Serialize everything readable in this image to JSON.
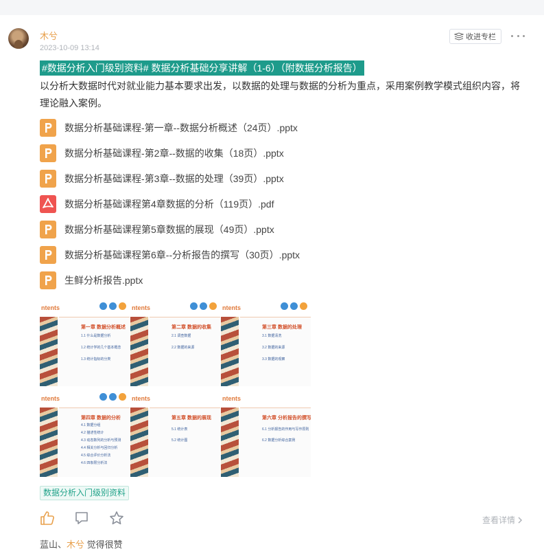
{
  "post": {
    "author": "木兮",
    "time": "2023-10-09 13:14",
    "collect_label": "收进专栏",
    "topic_line": "#数据分析入门级别资料# 数据分析基础分享讲解（1-6）（附数据分析报告）",
    "description": "以分析大数据时代对就业能力基本要求出发，以数据的处理与数据的分析为重点，采用案例教学模式组织内容，将理论融入案例。",
    "files": [
      {
        "name": "数据分析基础课程-第一章--数据分析概述（24页）.pptx",
        "type": "ppt",
        "icon": "ppt-file-icon"
      },
      {
        "name": "数据分析基础课程-第2章--数据的收集（18页）.pptx",
        "type": "ppt",
        "icon": "ppt-file-icon"
      },
      {
        "name": "数据分析基础课程-第3章--数据的处理（39页）.pptx",
        "type": "ppt",
        "icon": "ppt-file-icon"
      },
      {
        "name": "数据分析基础课程第4章数据的分析（119页）.pdf",
        "type": "pdf",
        "icon": "pdf-file-icon"
      },
      {
        "name": "数据分析基础课程第5章数据的展现（49页）.pptx",
        "type": "ppt",
        "icon": "ppt-file-icon"
      },
      {
        "name": "数据分析基础课程第6章--分析报告的撰写（30页）.pptx",
        "type": "ppt",
        "icon": "ppt-file-icon"
      },
      {
        "name": "生鲜分析报告.pptx",
        "type": "ppt",
        "icon": "ppt-file-icon"
      }
    ],
    "thumbnails": [
      {
        "header": "ntents",
        "chapter": "第一章 数据分析概述",
        "items": [
          "1.1 什么是数据分析",
          "1.2 统计学的几个基本概念",
          "1.3 统计指标的分类"
        ]
      },
      {
        "header": "ntents",
        "chapter": "第二章 数据的收集",
        "items": [
          "2.1 调查数据",
          "2.2 数据的来源"
        ]
      },
      {
        "header": "ntents",
        "chapter": "第三章 数据的处理",
        "items": [
          "3.1 数据清洗",
          "3.2 数据的来源",
          "3.3 数据的观察"
        ]
      },
      {
        "header": "ntents",
        "chapter": "第四章 数据的分析",
        "items": [
          "4.1 数据分组",
          "4.2 描述性统计",
          "4.3 动态数列的分析与预测",
          "4.4 相关分析与回归分析",
          "4.5 综合评价分析法",
          "4.6 四象限分析法"
        ]
      },
      {
        "header": "ntents",
        "chapter": "第五章 数据的展现",
        "items": [
          "5.1 统计表",
          "5.2 统计图"
        ]
      },
      {
        "header": "ntents",
        "chapter": "第六章 分析报告的撰写",
        "items": [
          "6.1 分析报告的作用与写作原则",
          "6.2 数据分析综合案例"
        ]
      }
    ],
    "tag": "数据分析入门级别资料",
    "detail_label": "查看详情",
    "likers": {
      "names": [
        "蓝山",
        "木兮"
      ],
      "separator": "、",
      "suffix": " 觉得很赞"
    }
  },
  "colors": {
    "accent": "#e8a04c",
    "topic_bg": "#1e9b8b",
    "tag_text": "#22a38a",
    "ppt_icon": "#f0a34b",
    "pdf_icon": "#ef5451"
  },
  "icons": {
    "like": "thumbs-up-icon",
    "comment": "comment-icon",
    "favorite": "star-icon",
    "more": "more-dots-icon",
    "collect": "column-collect-icon"
  }
}
